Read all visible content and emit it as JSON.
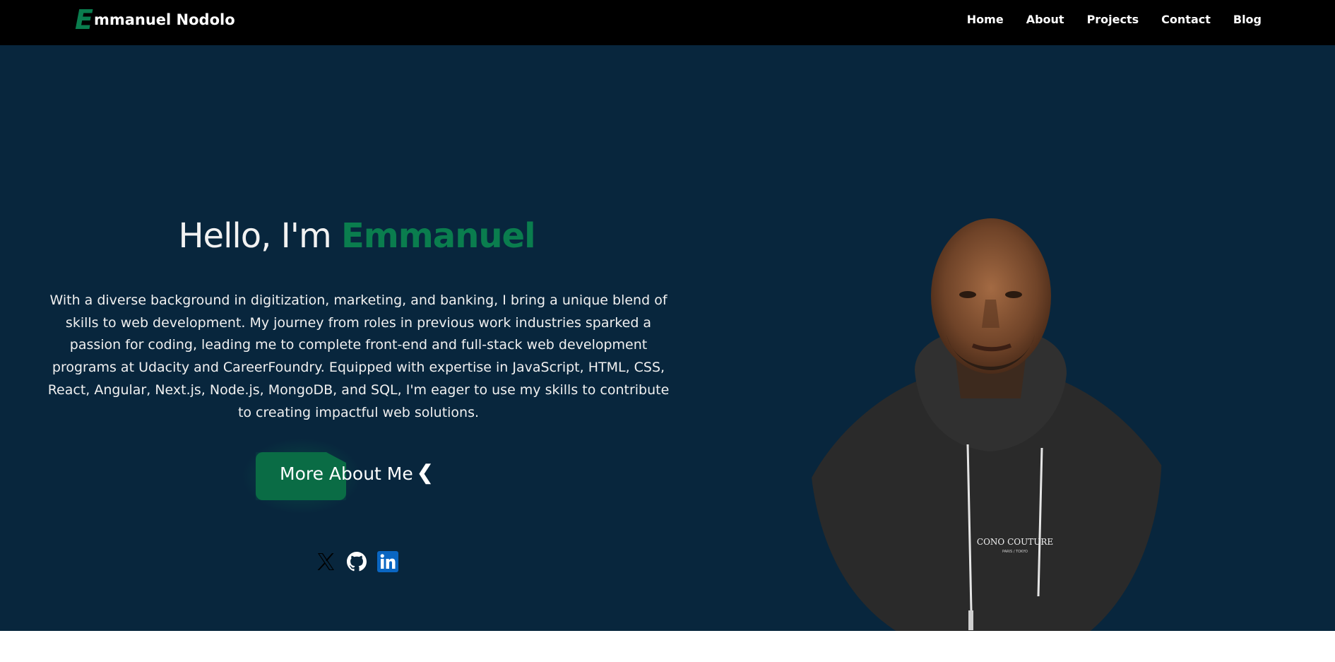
{
  "navbar": {
    "brand_letter": "E",
    "brand_rest": "mmanuel Nodolo",
    "links": [
      {
        "label": "Home"
      },
      {
        "label": "About"
      },
      {
        "label": "Projects"
      },
      {
        "label": "Contact"
      },
      {
        "label": "Blog"
      }
    ]
  },
  "hero": {
    "greeting": "Hello, I'm ",
    "name": "Emmanuel",
    "intro": "With a diverse background in digitization, marketing, and banking, I bring a unique blend of skills to web development. My journey from roles in previous work industries sparked a passion for coding, leading me to complete front-end and full-stack web development programs at Udacity and CareerFoundry. Equipped with expertise in JavaScript, HTML, CSS, React, Angular, Next.js, Node.js, MongoDB, and SQL, I'm eager to use my skills to contribute to creating impactful web solutions.",
    "cta_label": "More About Me",
    "cta_icon": "❮",
    "socials": [
      {
        "icon": "x-twitter-icon"
      },
      {
        "icon": "github-icon"
      },
      {
        "icon": "linkedin-icon"
      }
    ],
    "portrait_text": "CONO COUTURE",
    "portrait_subtext": "PARIS / TOKYO"
  },
  "colors": {
    "accent": "#0a7d4e",
    "hero_bg": "#08263d",
    "nav_bg": "#000000"
  }
}
